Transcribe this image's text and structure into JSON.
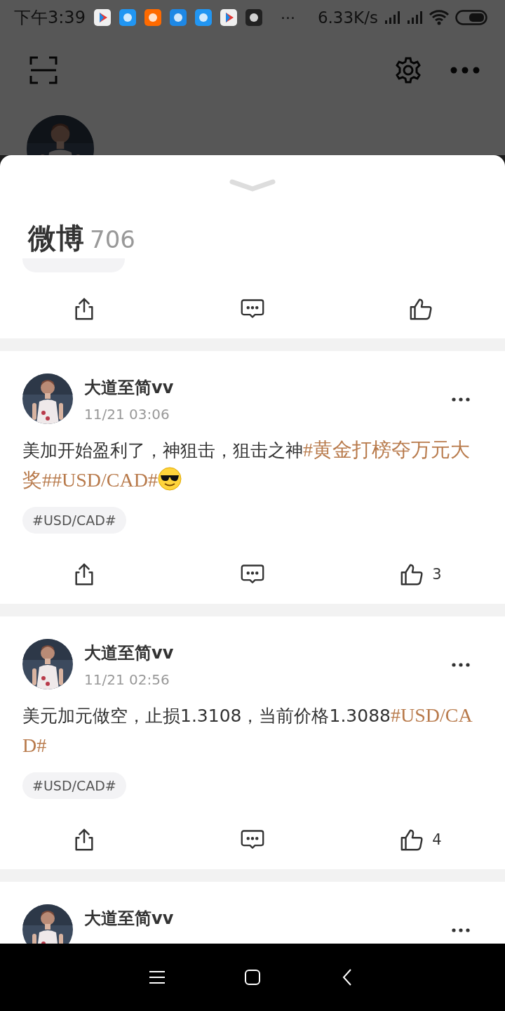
{
  "status_bar": {
    "time": "下午3:39",
    "more": "···",
    "speed": "6.33K/s"
  },
  "sheet": {
    "title": "微博",
    "count": "706"
  },
  "posts": [
    {
      "name": "大道至简vv",
      "time": "11/21 03:06",
      "segments": [
        {
          "kind": "plain",
          "text": "美加开始盈利了，神狙击，狙击之神"
        },
        {
          "kind": "topic",
          "text": "#黄金打榜夺万元大奖#"
        },
        {
          "kind": "topic",
          "text": "#USD/CAD#"
        },
        {
          "kind": "emoji"
        }
      ],
      "tag": "#USD/CAD#",
      "likes": "3"
    },
    {
      "name": "大道至简vv",
      "time": "11/21 02:56",
      "segments": [
        {
          "kind": "plain",
          "text": "美元加元做空，止损1.3108，当前价格1.3088"
        },
        {
          "kind": "topic",
          "text": "#USD/CAD#"
        }
      ],
      "tag": "#USD/CAD#",
      "likes": "4"
    }
  ],
  "last_post": {
    "name": "大道至简vv"
  }
}
